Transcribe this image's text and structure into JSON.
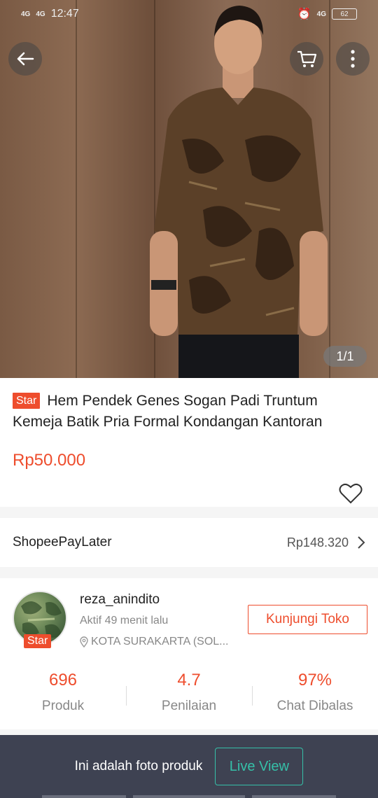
{
  "status_bar": {
    "network_1": "4G",
    "network_2": "4G",
    "time": "12:47",
    "network_3": "4G",
    "battery": "62"
  },
  "gallery": {
    "counter": "1/1"
  },
  "product": {
    "badge": "Star",
    "title": "Hem Pendek Genes Sogan Padi Truntum Kemeja Batik Pria Formal Kondangan Kantoran",
    "price": "Rp50.000"
  },
  "paylater": {
    "label": "ShopeePayLater",
    "amount": "Rp148.320"
  },
  "shop": {
    "name": "reza_anindito",
    "active": "Aktif 49 menit lalu",
    "location": "KOTA SURAKARTA (SOL...",
    "badge": "Star",
    "visit_label": "Kunjungi Toko",
    "stats": [
      {
        "value": "696",
        "label": "Produk"
      },
      {
        "value": "4.7",
        "label": "Penilaian"
      },
      {
        "value": "97%",
        "label": "Chat Dibalas"
      }
    ]
  },
  "bottom_bar": {
    "text": "Ini adalah foto produk",
    "live_label": "Live View"
  },
  "colors": {
    "accent": "#ee4d2d",
    "live": "#35c0a8",
    "bottom_bar": "#3e4252"
  }
}
